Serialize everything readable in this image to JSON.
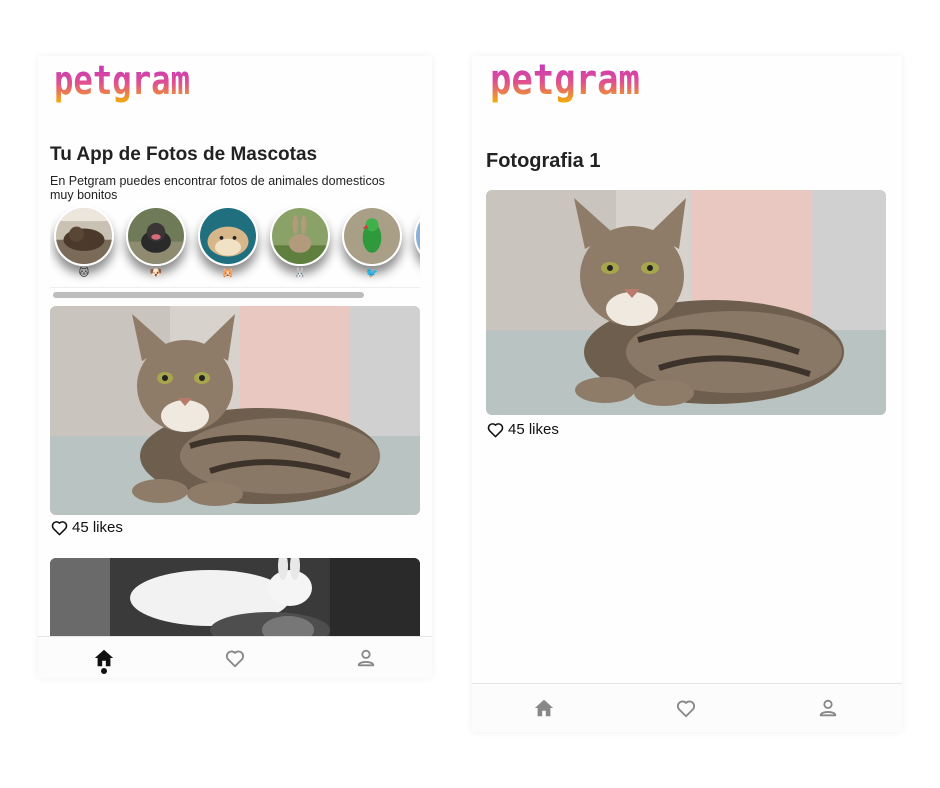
{
  "app": {
    "logo_text": "petgram",
    "gradient": [
      "#a83cc8",
      "#f7b800"
    ]
  },
  "home_screen": {
    "title": "Tu App de Fotos de Mascotas",
    "subtitle": "En Petgram puedes encontrar fotos de animales domesticos muy bonitos",
    "categories": [
      {
        "emoji": "🐱"
      },
      {
        "emoji": "🐶"
      },
      {
        "emoji": "🐹"
      },
      {
        "emoji": "🐰"
      },
      {
        "emoji": "🐦"
      }
    ],
    "photos": [
      {
        "likes": "45 likes"
      }
    ]
  },
  "detail_screen": {
    "title": "Fotografia 1",
    "likes": "45 likes"
  },
  "navbar": {
    "items": [
      "home-icon",
      "heart-icon",
      "user-icon"
    ],
    "active_color": "#111111",
    "inactive_color": "#888888"
  }
}
